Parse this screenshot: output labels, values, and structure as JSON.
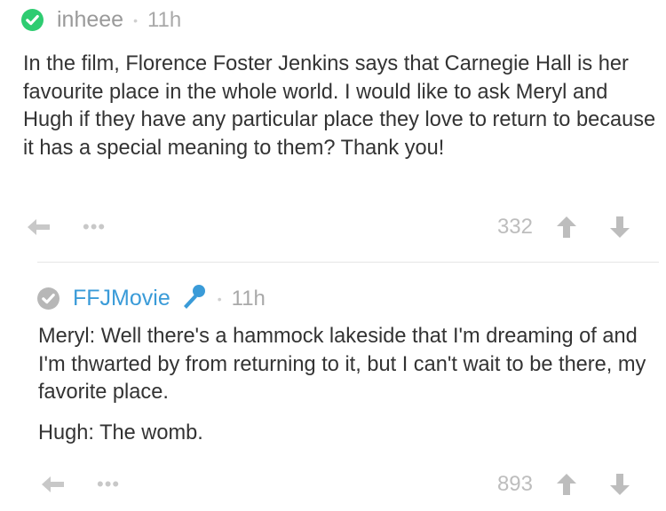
{
  "colors": {
    "verified_green": "#2ecc71",
    "moderator_gray": "#b7b7b7",
    "link_blue": "#3a9bd8",
    "body_text": "#333333",
    "muted": "#b0b0b0"
  },
  "comments": [
    {
      "username": "inheee",
      "username_color": "#9a9a9a",
      "badge_icon": "check-circle-icon",
      "separator": "•",
      "time": "11h",
      "paragraphs": [
        "In the film, Florence Foster Jenkins says that Carnegie Hall is her favourite place in the whole world. I would like to ask Meryl and Hugh if they have any particular place they love to return to because it has a special meaning to them? Thank you!"
      ],
      "more": "•••",
      "score": "332",
      "icons": [
        "reply-icon",
        "upvote-icon",
        "downvote-icon"
      ]
    },
    {
      "username": "FFJMovie",
      "username_color": "#3a9bd8",
      "badge_icon": "check-circle-icon",
      "flair_icon": "microphone-icon",
      "separator": "•",
      "time": "11h",
      "paragraphs": [
        "Meryl: Well there's a hammock lakeside that I'm dreaming of and I'm thwarted by from returning to it, but I can't wait to be there, my favorite place.",
        "Hugh: The womb."
      ],
      "more": "•••",
      "score": "893",
      "icons": [
        "reply-icon",
        "upvote-icon",
        "downvote-icon"
      ]
    }
  ]
}
